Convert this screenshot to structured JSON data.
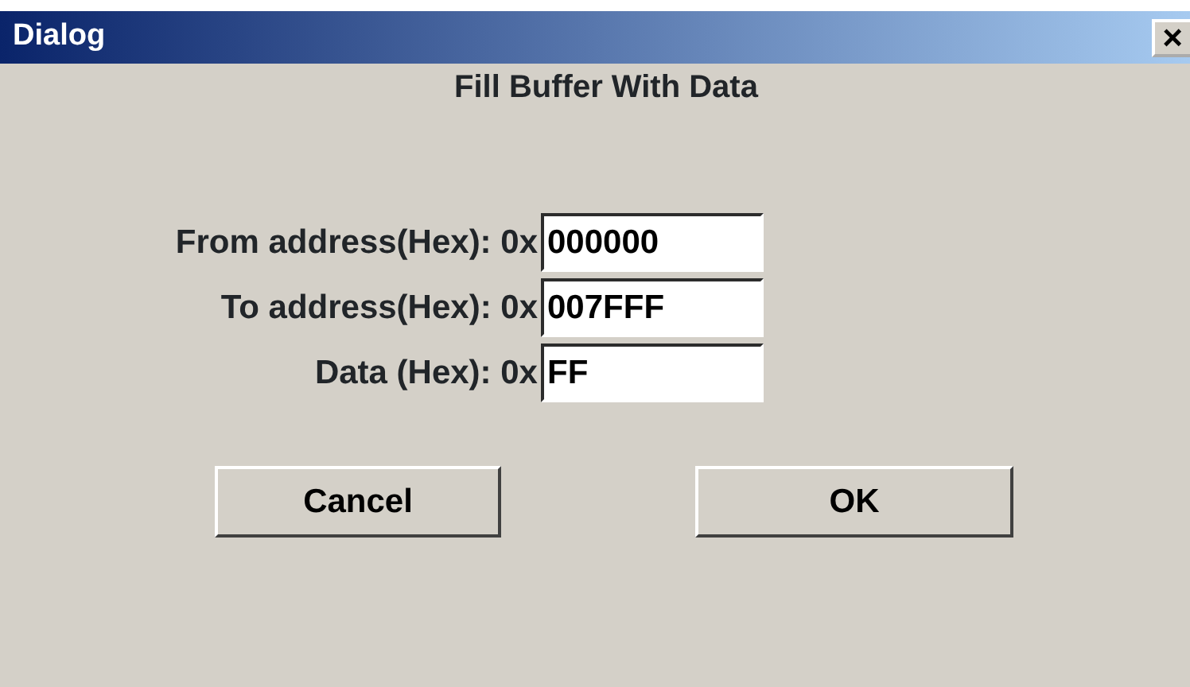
{
  "window": {
    "title": "Dialog",
    "close": "×"
  },
  "heading": "Fill Buffer With Data",
  "fields": [
    {
      "label": "From address(Hex): 0x",
      "value": "000000"
    },
    {
      "label": "To address(Hex): 0x",
      "value": "007FFF"
    },
    {
      "label": "Data (Hex): 0x",
      "value": "FF"
    }
  ],
  "buttons": [
    "Cancel",
    "OK"
  ]
}
